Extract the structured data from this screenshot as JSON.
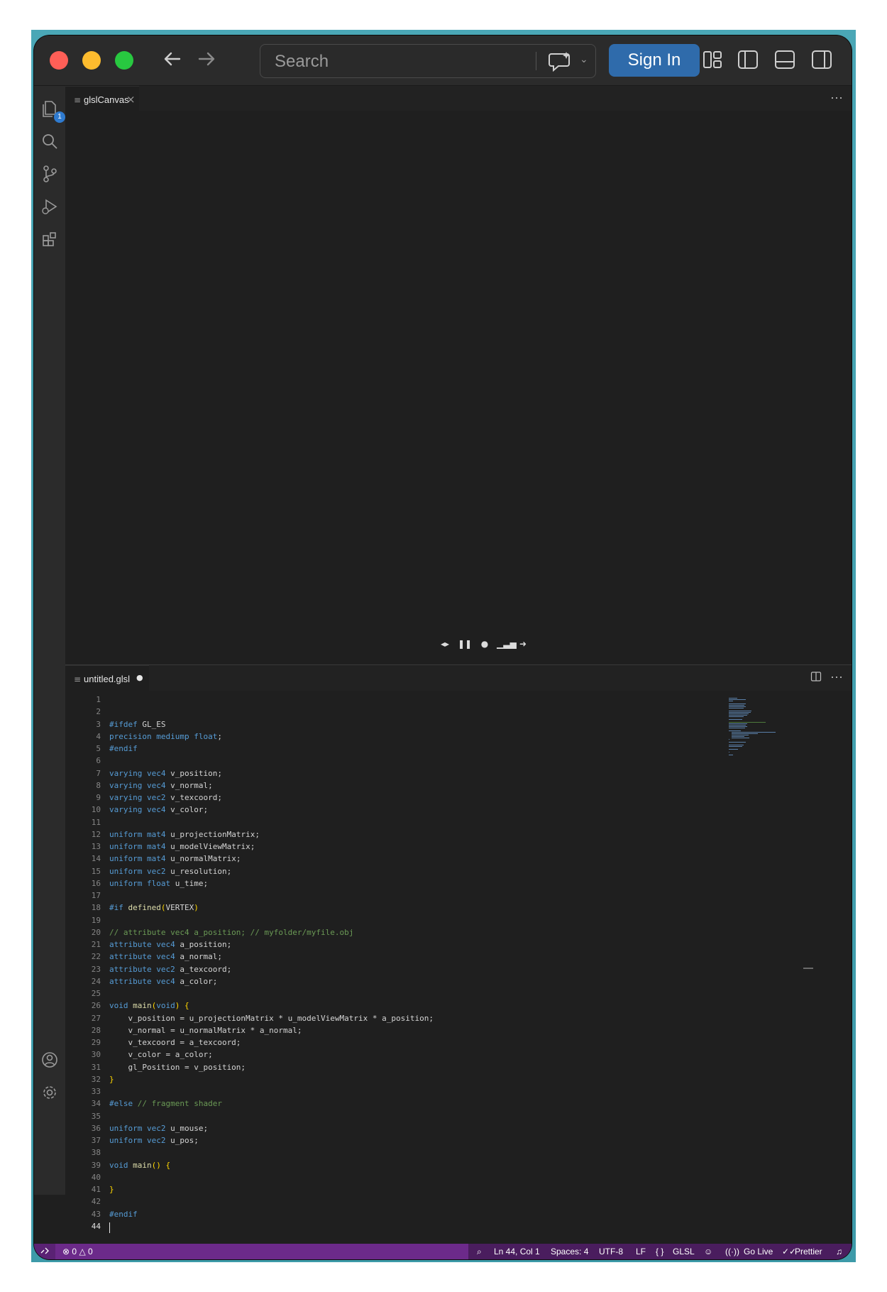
{
  "titlebar": {
    "search_placeholder": "Search",
    "sign_in_label": "Sign In"
  },
  "activity_bar": {
    "explorer_badge": "1"
  },
  "top_editor": {
    "tab_label": "glslCanvas",
    "more_label": "···"
  },
  "bottom_editor": {
    "tab_label": "untitled.glsl",
    "more_label": "···",
    "lines": [
      "",
      "",
      "#ifdef GL_ES",
      "precision mediump float;",
      "#endif",
      "",
      "varying vec4 v_position;",
      "varying vec4 v_normal;",
      "varying vec2 v_texcoord;",
      "varying vec4 v_color;",
      "",
      "uniform mat4 u_projectionMatrix;",
      "uniform mat4 u_modelViewMatrix;",
      "uniform mat4 u_normalMatrix;",
      "uniform vec2 u_resolution;",
      "uniform float u_time;",
      "",
      "#if defined(VERTEX)",
      "",
      "// attribute vec4 a_position; // myfolder/myfile.obj",
      "attribute vec4 a_position;",
      "attribute vec4 a_normal;",
      "attribute vec2 a_texcoord;",
      "attribute vec4 a_color;",
      "",
      "void main(void) {",
      "    v_position = u_projectionMatrix * u_modelViewMatrix * a_position;",
      "    v_normal = u_normalMatrix * a_normal;",
      "    v_texcoord = a_texcoord;",
      "    v_color = a_color;",
      "    gl_Position = v_position;",
      "}",
      "",
      "#else // fragment shader",
      "",
      "uniform vec2 u_mouse;",
      "uniform vec2 u_pos;",
      "",
      "void main() {",
      "",
      "}",
      "",
      "#endif",
      ""
    ],
    "active_line": 44
  },
  "statusbar": {
    "errors": "0",
    "warnings": "0",
    "cursor_position": "Ln 44, Col 1",
    "indentation": "Spaces: 4",
    "encoding": "UTF-8",
    "eol": "LF",
    "language": "GLSL",
    "go_live": "Go Live",
    "prettier": "Prettier"
  },
  "icons": {
    "back": "arrow-left-icon",
    "forward": "arrow-right-icon",
    "copilot": "copilot-chat-icon",
    "explorer": "files-icon",
    "search": "search-icon",
    "scm": "source-control-icon",
    "debug": "run-debug-icon",
    "extensions": "extensions-icon",
    "accounts": "account-icon",
    "settings": "gear-icon"
  },
  "colors": {
    "statusbar": "#6c2a8a",
    "signin": "#2f6bab",
    "keyword": "#569cd6",
    "comment": "#6a9955"
  }
}
